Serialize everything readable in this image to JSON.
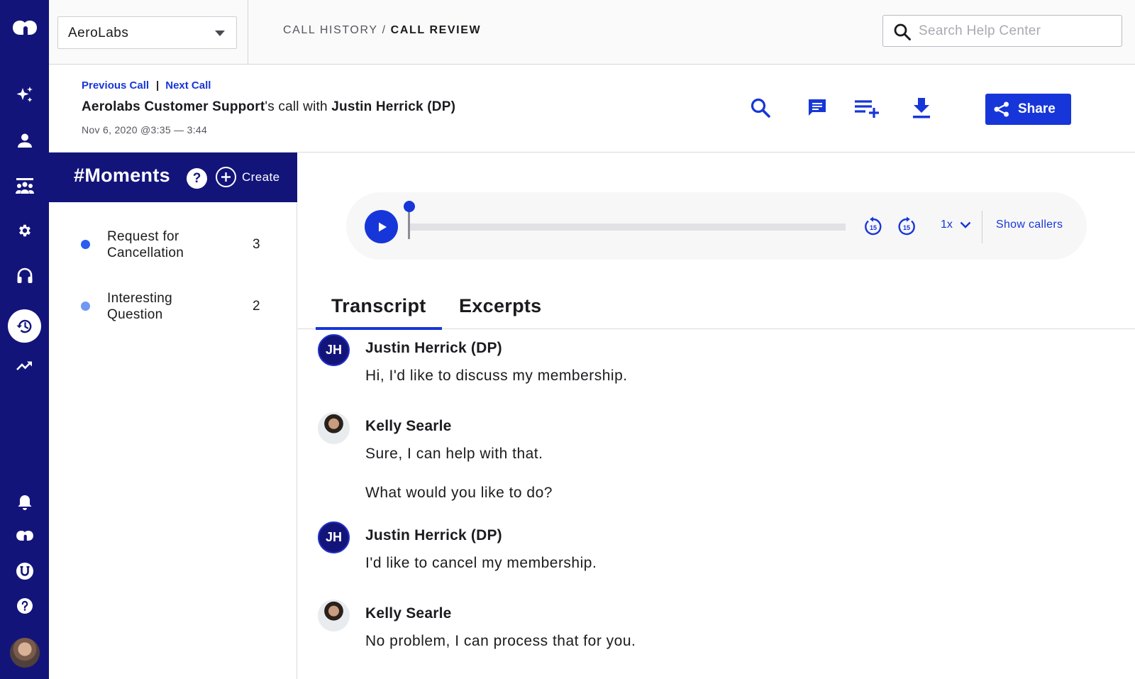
{
  "org_selector": {
    "value": "AeroLabs"
  },
  "breadcrumb": {
    "parent": "CALL HISTORY",
    "separator": "/",
    "current": "CALL REVIEW"
  },
  "help_search": {
    "placeholder": "Search Help Center"
  },
  "call_header": {
    "previous_label": "Previous Call",
    "divider": "|",
    "next_label": "Next Call",
    "agent": "Aerolabs Customer Support",
    "connector": "'s call with ",
    "caller": "Justin Herrick (DP)",
    "date": "Nov 6, 2020 @3:35 — 3:44",
    "share_label": "Share"
  },
  "toolbar_icons": [
    "search-icon",
    "comment-icon",
    "add-to-playlist-icon",
    "download-icon",
    "share-icon"
  ],
  "rail_icons": [
    "dialpad-logo-icon",
    "sparkle-icon",
    "person-icon",
    "team-icon",
    "gear-icon",
    "headset-icon",
    "history-icon",
    "trending-icon",
    "bell-icon",
    "dialpad-icon",
    "u-badge-icon",
    "help-icon"
  ],
  "moments": {
    "title": "#Moments",
    "help": "?",
    "create_label": "Create",
    "items": [
      {
        "label": "Request for Cancellation",
        "count": "3",
        "color": "#2a5df0"
      },
      {
        "label": "Interesting Question",
        "count": "2",
        "color": "#6f97f3"
      }
    ]
  },
  "player": {
    "speed": "1x",
    "skip_back": "15",
    "skip_forward": "15",
    "show_callers": "Show callers",
    "progress": 0
  },
  "tabs": [
    {
      "label": "Transcript",
      "active": true
    },
    {
      "label": "Excerpts",
      "active": false
    }
  ],
  "transcript": [
    {
      "speaker": "Justin Herrick (DP)",
      "initials": "JH",
      "lines": [
        "Hi, I'd like to discuss my membership."
      ]
    },
    {
      "speaker": "Kelly Searle",
      "initials": "",
      "lines": [
        "Sure, I can help with that.",
        "What would you like to do?"
      ]
    },
    {
      "speaker": "Justin Herrick (DP)",
      "initials": "JH",
      "lines": [
        "I'd like to cancel my membership."
      ]
    },
    {
      "speaker": "Kelly Searle",
      "initials": "",
      "lines": [
        "No problem, I can process that for you."
      ]
    }
  ],
  "colors": {
    "navy": "#13147a",
    "accent": "#1736d9"
  }
}
